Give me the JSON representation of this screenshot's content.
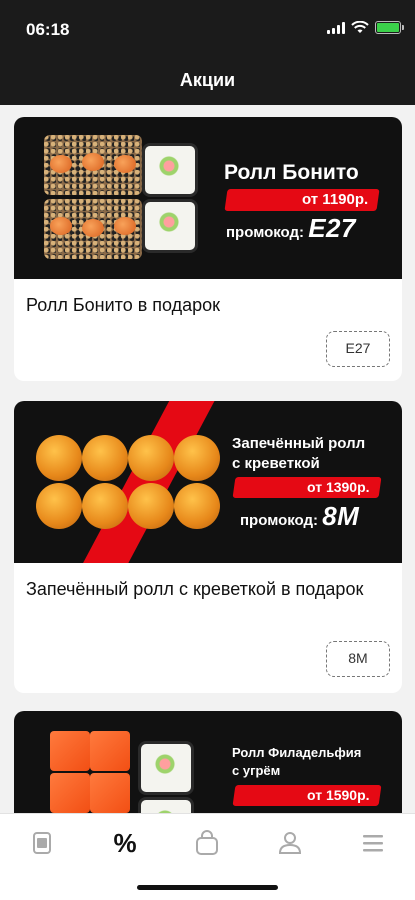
{
  "status": {
    "time": "06:18"
  },
  "header": {
    "title": "Акции"
  },
  "promos": [
    {
      "banner_name": "Ролл Бонито",
      "banner_price": "от 1190р.",
      "banner_promo_label": "промокод:",
      "banner_promo_code": "E27",
      "title": "Ролл Бонито в подарок",
      "code": "E27"
    },
    {
      "banner_name_line1": "Запечённый ролл",
      "banner_name_line2": "с креветкой",
      "banner_price": "от 1390р.",
      "banner_promo_label": "промокод:",
      "banner_promo_code": "8M",
      "title": "Запечённый ролл с креветкой в подарок",
      "code": "8M"
    },
    {
      "banner_name_line1": "Ролл Филадельфия",
      "banner_name_line2": "с угрём",
      "banner_price": "от 1590р."
    }
  ],
  "tabbar": {
    "items": [
      {
        "icon": "menu-book-icon",
        "active": false
      },
      {
        "icon": "percent-icon",
        "active": true
      },
      {
        "icon": "shopping-bag-icon",
        "active": false
      },
      {
        "icon": "profile-icon",
        "active": false
      },
      {
        "icon": "hamburger-menu-icon",
        "active": false
      }
    ],
    "percent_glyph": "%"
  },
  "colors": {
    "accent": "#e50914",
    "bar": "#1b1b1b",
    "background": "#f2f2f2",
    "inactive_icon": "#aaaaaa"
  }
}
